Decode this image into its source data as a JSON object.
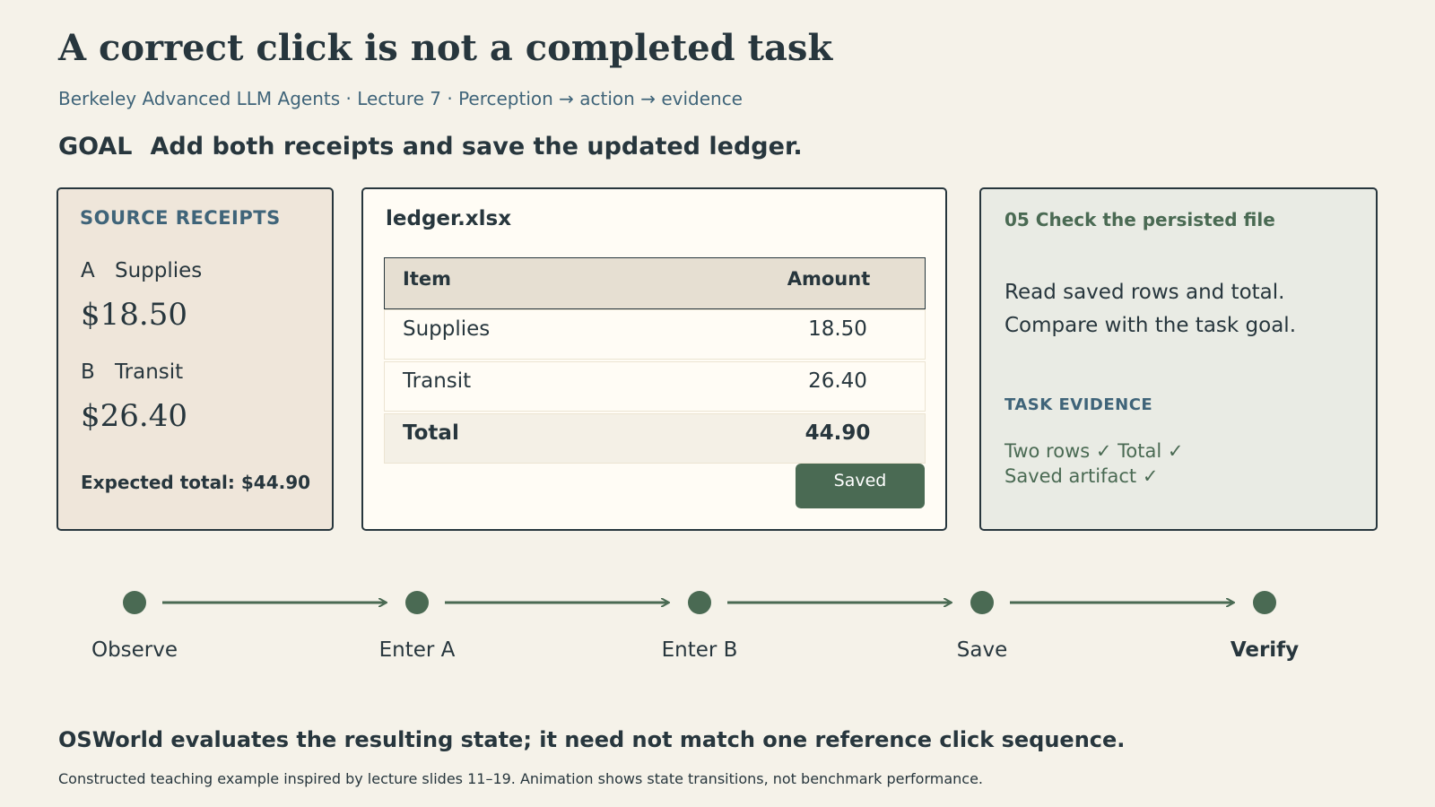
{
  "title": "A correct click is not a completed task",
  "subtitle": "Berkeley Advanced LLM Agents · Lecture 7 · Perception → action → evidence",
  "goal": {
    "label": "GOAL",
    "text": "Add both receipts and save the updated ledger."
  },
  "receipts": {
    "heading": "SOURCE RECEIPTS",
    "items": [
      {
        "letter": "A",
        "name": "Supplies",
        "amount": "$18.50"
      },
      {
        "letter": "B",
        "name": "Transit",
        "amount": "$26.40"
      }
    ],
    "expected": "Expected total: $44.90"
  },
  "ledger": {
    "filename": "ledger.xlsx",
    "columns": [
      "Item",
      "Amount"
    ],
    "rows": [
      {
        "item": "Supplies",
        "amount": "18.50"
      },
      {
        "item": "Transit",
        "amount": "26.40"
      }
    ],
    "total": {
      "item": "Total",
      "amount": "44.90"
    },
    "saved_label": "Saved"
  },
  "verify": {
    "heading": "05  Check the persisted file",
    "lines": [
      "Read saved rows and total.",
      "Compare with the task goal."
    ],
    "evidence_heading": "TASK EVIDENCE",
    "evidence_lines": [
      "Two rows ✓   Total ✓",
      "Saved artifact ✓"
    ]
  },
  "steps": [
    "Observe",
    "Enter A",
    "Enter B",
    "Save",
    "Verify"
  ],
  "conclusion": "OSWorld evaluates the resulting state; it need not match one reference click sequence.",
  "footnote": "Constructed teaching example inspired by lecture slides 11–19. Animation shows state transitions, not benchmark performance.",
  "colors": {
    "background": "#f5f2e9",
    "accent_green": "#4a6a53",
    "accent_blue": "#3f6479",
    "ink": "#27363d"
  }
}
